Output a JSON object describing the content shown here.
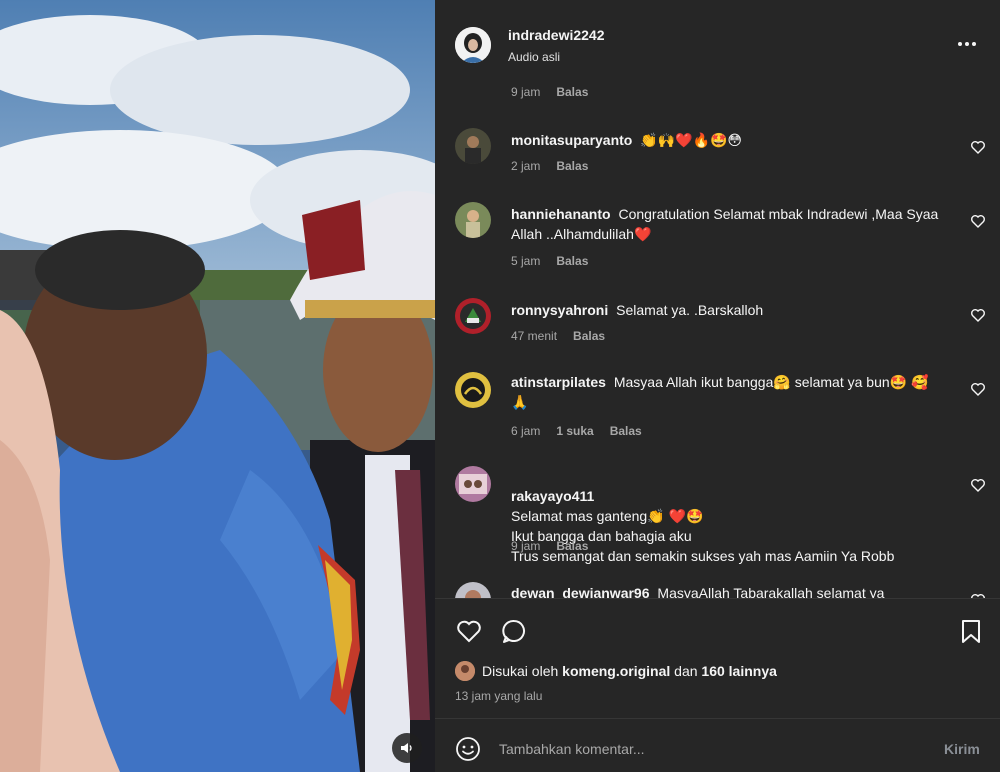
{
  "post": {
    "username": "indradewi2242",
    "audio": "Audio asli",
    "first_meta": {
      "time": "9 jam",
      "reply": "Balas"
    }
  },
  "comments": [
    {
      "user": "monitasuparyanto",
      "text": "👏🙌❤️🔥🤩😳",
      "time": "2 jam",
      "likes": "",
      "reply": "Balas"
    },
    {
      "user": "hanniehananto",
      "text": "Congratulation Selamat mbak Indradewi ,Maa Syaa Allah ..Alhamdulilah❤️",
      "time": "5 jam",
      "likes": "",
      "reply": "Balas"
    },
    {
      "user": "ronnysyahroni",
      "text": "Selamat ya. .Barskalloh",
      "time": "47 menit",
      "likes": "",
      "reply": "Balas"
    },
    {
      "user": "atinstarpilates",
      "text": "Masyaa Allah ikut bangga🤗 selamat ya bun🤩 🥰🙏",
      "time": "6 jam",
      "likes": "1 suka",
      "reply": "Balas"
    },
    {
      "user": "rakayayo411",
      "text": "Selamat mas ganteng👏 ❤️🤩\nIkut bangga dan bahagia aku\nTrus semangat dan semakin sukses yah mas Aamiin Ya Robb",
      "time": "9 jam",
      "likes": "",
      "reply": "Balas"
    },
    {
      "user": "dewan_dewianwar96",
      "text": "MasyaAllah Tabarakallah selamat ya",
      "time": "",
      "likes": "",
      "reply": ""
    }
  ],
  "actions": {
    "liked_by_prefix": "Disukai oleh",
    "liked_by_user": "komeng.original",
    "liked_by_and": "dan",
    "liked_by_others": "160 lainnya",
    "time_ago": "13 jam yang lalu"
  },
  "composer": {
    "placeholder": "Tambahkan komentar...",
    "post_label": "Kirim"
  },
  "icons": {
    "like": "heart-icon",
    "comment": "comment-bubble-icon",
    "save": "bookmark-icon",
    "emoji": "smiley-icon",
    "more": "more-horizontal-icon",
    "mute": "speaker-icon"
  },
  "colors": {
    "panel_bg": "#262626",
    "text": "#f5f5f5",
    "secondary_text": "#a8a8a8",
    "divider": "#363636"
  }
}
